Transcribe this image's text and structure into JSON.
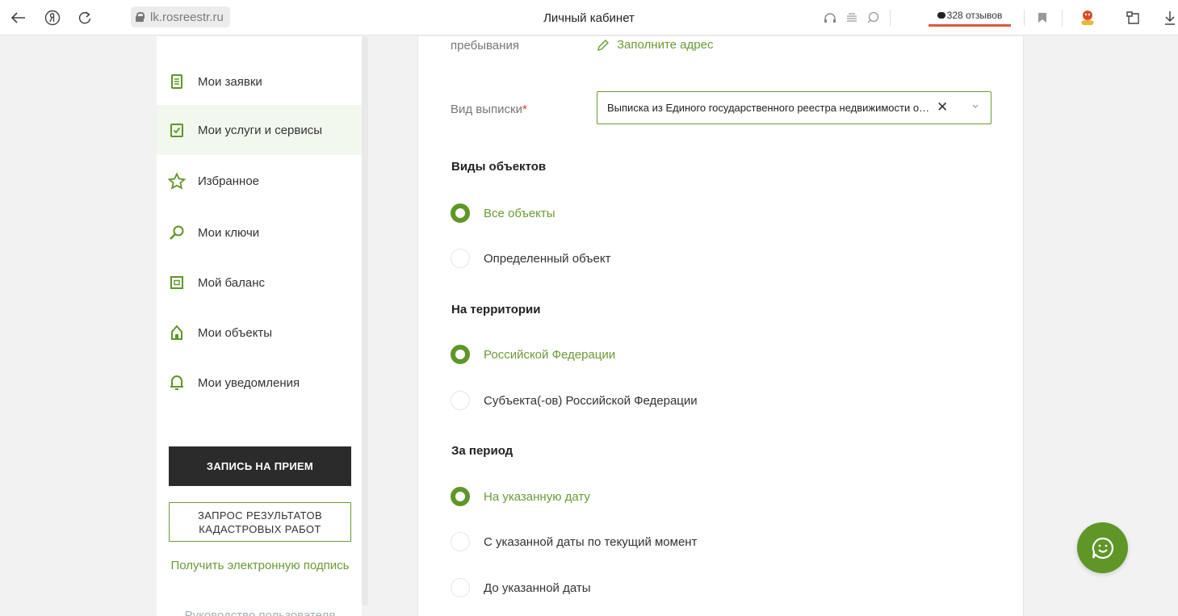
{
  "browser": {
    "url": "lk.rosreestr.ru",
    "title": "Личный кабинет",
    "reviews_label": "328 отзывов"
  },
  "sidebar": {
    "items": [
      {
        "label": "Мои заявки",
        "icon": "document-icon"
      },
      {
        "label": "Мои услуги и сервисы",
        "icon": "checklist-icon",
        "active": true
      },
      {
        "label": "Избранное",
        "icon": "star-icon"
      },
      {
        "label": "Мои ключи",
        "icon": "key-icon"
      },
      {
        "label": "Мой баланс",
        "icon": "wallet-icon"
      },
      {
        "label": "Мои объекты",
        "icon": "house-icon"
      },
      {
        "label": "Мои уведомления",
        "icon": "bell-icon"
      }
    ],
    "appointment_button": "ЗАПИСЬ НА ПРИЕМ",
    "cadastral_button": "ЗАПРОС РЕЗУЛЬТАТОВ КАДАСТРОВЫХ РАБОТ",
    "signature_link": "Получить электронную подпись",
    "guide_link": "Руководство пользователя"
  },
  "form": {
    "stay_label": "пребывания",
    "fill_address": "Заполните адрес",
    "extract_label": "Вид выписки",
    "required_mark": "*",
    "extract_value": "Выписка из Единого государственного реестра недвижимости о переходе прав",
    "clear_symbol": "✕",
    "object_types": {
      "title": "Виды объектов",
      "options": [
        {
          "label": "Все объекты",
          "selected": true
        },
        {
          "label": "Определенный объект",
          "selected": false
        }
      ]
    },
    "territory": {
      "title": "На территории",
      "options": [
        {
          "label": "Российской Федерации",
          "selected": true
        },
        {
          "label": "Субъекта(-ов) Российской Федерации",
          "selected": false
        }
      ]
    },
    "period": {
      "title": "За период",
      "options": [
        {
          "label": "На указанную дату",
          "selected": true
        },
        {
          "label": "С указанной даты по текущий момент",
          "selected": false
        },
        {
          "label": "До указанной даты",
          "selected": false
        }
      ]
    }
  },
  "colors": {
    "accent": "#5f9627",
    "link": "#6b9a36",
    "dark_button": "#2b2b2b",
    "active_row": "#f3f8ee"
  }
}
